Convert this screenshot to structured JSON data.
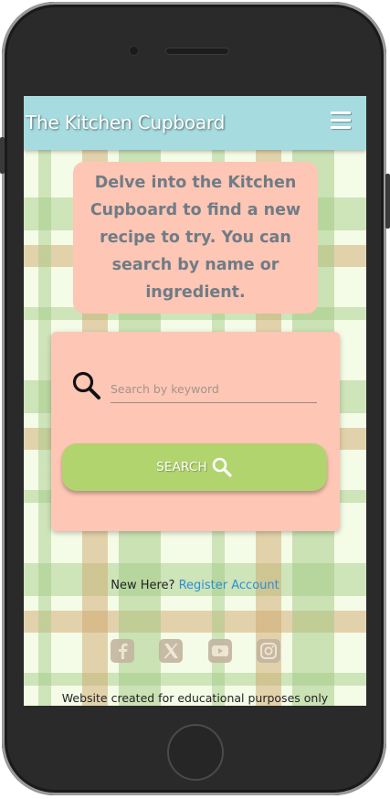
{
  "navbar": {
    "brand": "The Kitchen Cupboard"
  },
  "intro": {
    "text": "Delve into the Kitchen Cupboard to find a new recipe to try. You can search by name or ingredient."
  },
  "search": {
    "placeholder": "Search by keyword",
    "value": "",
    "button_label": "SEARCH"
  },
  "register": {
    "prompt": "New Here?",
    "link_label": "Register Account"
  },
  "socials": [
    {
      "icon": "facebook-icon"
    },
    {
      "icon": "x-icon"
    },
    {
      "icon": "youtube-icon"
    },
    {
      "icon": "instagram-icon"
    }
  ],
  "footer": {
    "text": "Website created for educational purposes only"
  },
  "colors": {
    "navbar": "#a6dbdf",
    "card": "#fec6b4",
    "button": "#b1d46e",
    "link": "#2a8fd6",
    "intro_text": "#6f7c86"
  }
}
